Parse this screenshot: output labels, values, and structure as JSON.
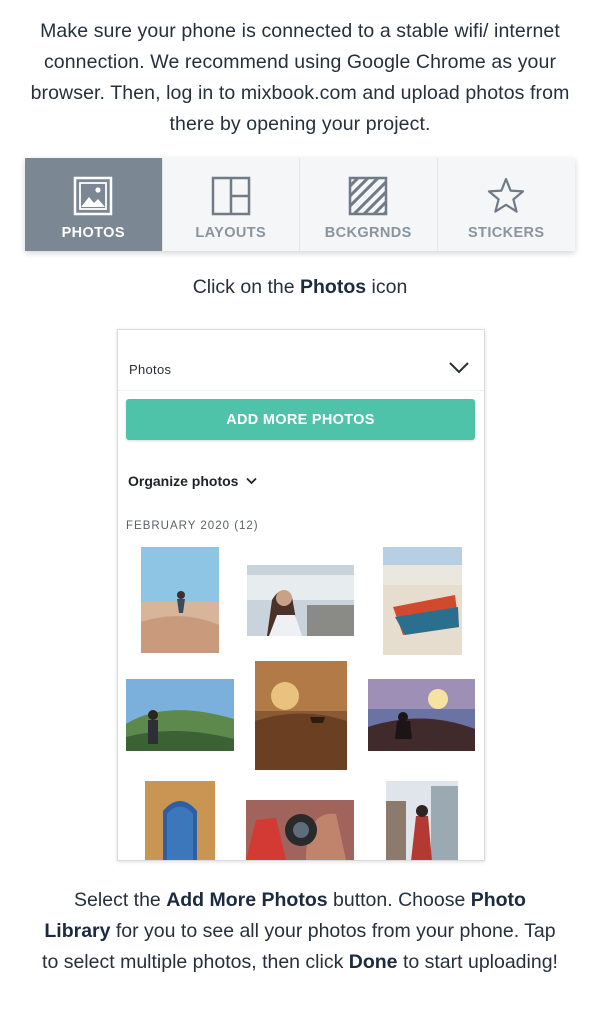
{
  "intro": "Make sure your phone is connected to a stable wifi/ internet connection. We recommend using Google Chrome as your browser. Then, log in to mixbook.com and upload photos from there by opening your project.",
  "tabs": [
    {
      "label": "PHOTOS",
      "icon": "photo-icon",
      "active": true
    },
    {
      "label": "LAYOUTS",
      "icon": "layout-icon",
      "active": false
    },
    {
      "label": "BCKGRNDS",
      "icon": "background-icon",
      "active": false
    },
    {
      "label": "STICKERS",
      "icon": "star-icon",
      "active": false
    }
  ],
  "caption1": {
    "before": "Click on the ",
    "bold": "Photos",
    "after": " icon"
  },
  "panel": {
    "title": "Photos",
    "add_button": "ADD MORE PHOTOS",
    "organize": "Organize photos",
    "month": "FEBRUARY 2020",
    "count": "(12)"
  },
  "caption2": {
    "t1": "Select the ",
    "b1": "Add More Photos",
    "t2": " button. Choose ",
    "b2": "Photo Library",
    "t3": " for you to see all your photos from your phone. Tap to select multiple photos, then click ",
    "b3": "Done",
    "t4": " to start uploading!"
  },
  "colors": {
    "accent": "#4fc3aa",
    "active_tab": "#7b8793",
    "tab_bar": "#f4f6f8"
  }
}
